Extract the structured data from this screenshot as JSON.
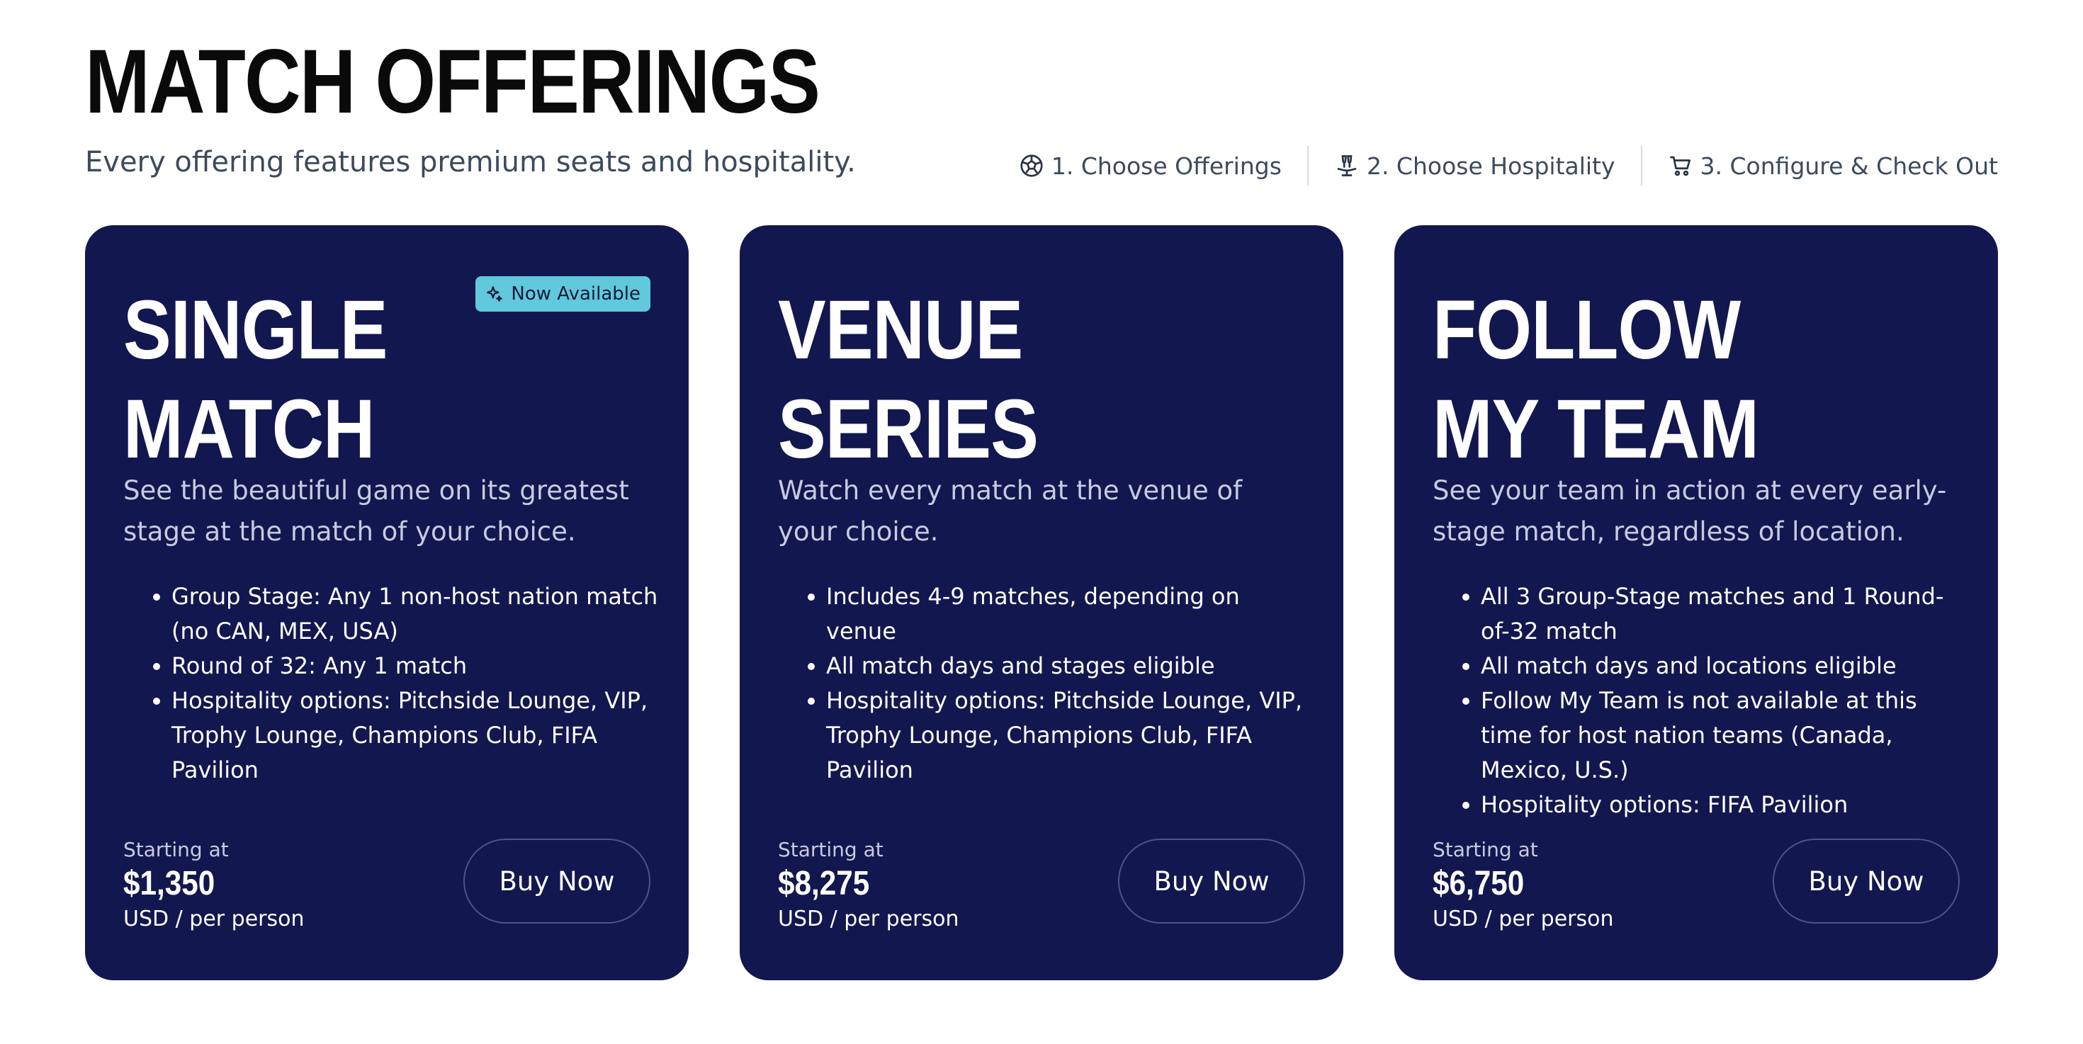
{
  "header": {
    "title": "MATCH OFFERINGS",
    "subtitle": "Every offering features premium seats and hospitality."
  },
  "steps": [
    {
      "label": "1. Choose Offerings",
      "icon": "soccer-ball-icon"
    },
    {
      "label": "2. Choose Hospitality",
      "icon": "champagne-tray-icon"
    },
    {
      "label": "3. Configure & Check Out",
      "icon": "cart-icon"
    }
  ],
  "cards": [
    {
      "title": "SINGLE MATCH",
      "badge": "Now Available",
      "description": "See the beautiful game on its greatest stage at the match of your choice.",
      "features": [
        "Group Stage: Any 1 non-host nation match (no CAN, MEX, USA)",
        "Round of 32: Any 1 match",
        "Hospitality options: Pitchside Lounge, VIP, Trophy Lounge, Champions Club, FIFA Pavilion"
      ],
      "price_label": "Starting at",
      "price": "$1,350",
      "price_unit": "USD / per person",
      "button_label": "Buy Now"
    },
    {
      "title": "VENUE SERIES",
      "description": "Watch every match at the venue of your choice.",
      "features": [
        "Includes 4-9 matches, depending on venue",
        "All match days and stages eligible",
        "Hospitality options: Pitchside Lounge, VIP, Trophy Lounge, Champions Club, FIFA Pavilion"
      ],
      "price_label": "Starting at",
      "price": "$8,275",
      "price_unit": "USD / per person",
      "button_label": "Buy Now"
    },
    {
      "title": "FOLLOW MY TEAM",
      "description": "See your team in action at every early-stage match, regardless of location.",
      "features": [
        "All 3 Group-Stage matches and 1 Round-of-32 match",
        "All match days and locations eligible",
        "Follow My Team is not available at this time for host nation teams (Canada, Mexico, U.S.)",
        "Hospitality options: FIFA Pavilion"
      ],
      "price_label": "Starting at",
      "price": "$6,750",
      "price_unit": "USD / per person",
      "button_label": "Buy Now"
    }
  ],
  "colors": {
    "card_background": "#13174f",
    "badge_background": "#62c8dc",
    "title_text": "#0a0a0a",
    "subtitle_text": "#3d4a5c"
  }
}
